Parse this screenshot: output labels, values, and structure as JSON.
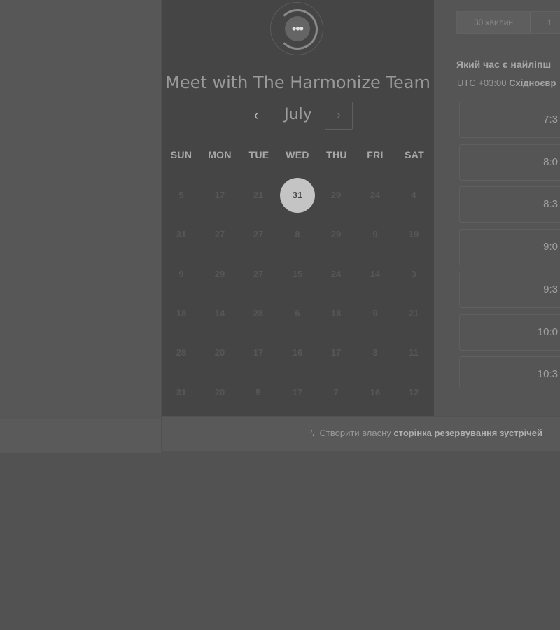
{
  "calendar": {
    "title": "Meet with The Harmonize Team",
    "month": "July",
    "prev_icon": "‹",
    "next_icon": "›",
    "weekdays": [
      "SUN",
      "MON",
      "TUE",
      "WED",
      "THU",
      "FRI",
      "SAT"
    ],
    "weeks": [
      [
        "5",
        "17",
        "21",
        "31",
        "29",
        "24",
        "4"
      ],
      [
        "31",
        "27",
        "27",
        "8",
        "29",
        "9",
        "19"
      ],
      [
        "9",
        "29",
        "27",
        "15",
        "24",
        "14",
        "3"
      ],
      [
        "18",
        "14",
        "28",
        "6",
        "18",
        "9",
        "21"
      ],
      [
        "28",
        "20",
        "17",
        "16",
        "17",
        "3",
        "11"
      ],
      [
        "31",
        "20",
        "5",
        "17",
        "7",
        "16",
        "12"
      ]
    ],
    "selected_day": "31"
  },
  "duration_tabs": [
    {
      "label": "30 хвилин"
    },
    {
      "label": "1"
    }
  ],
  "time_panel": {
    "question": "Який час є найліпш",
    "timezone_prefix": "UTC +03:00",
    "timezone_name": "Східноєвр",
    "slots": [
      "7:3",
      "8:0",
      "8:3",
      "9:0",
      "9:3",
      "10:0",
      "10:3"
    ]
  },
  "footer": {
    "text": "Створити власну",
    "bold": "сторінка резервування зустрічей"
  },
  "colors": {
    "selected_day_bg": "#c4c4c4",
    "panel_bg": "#454545"
  }
}
